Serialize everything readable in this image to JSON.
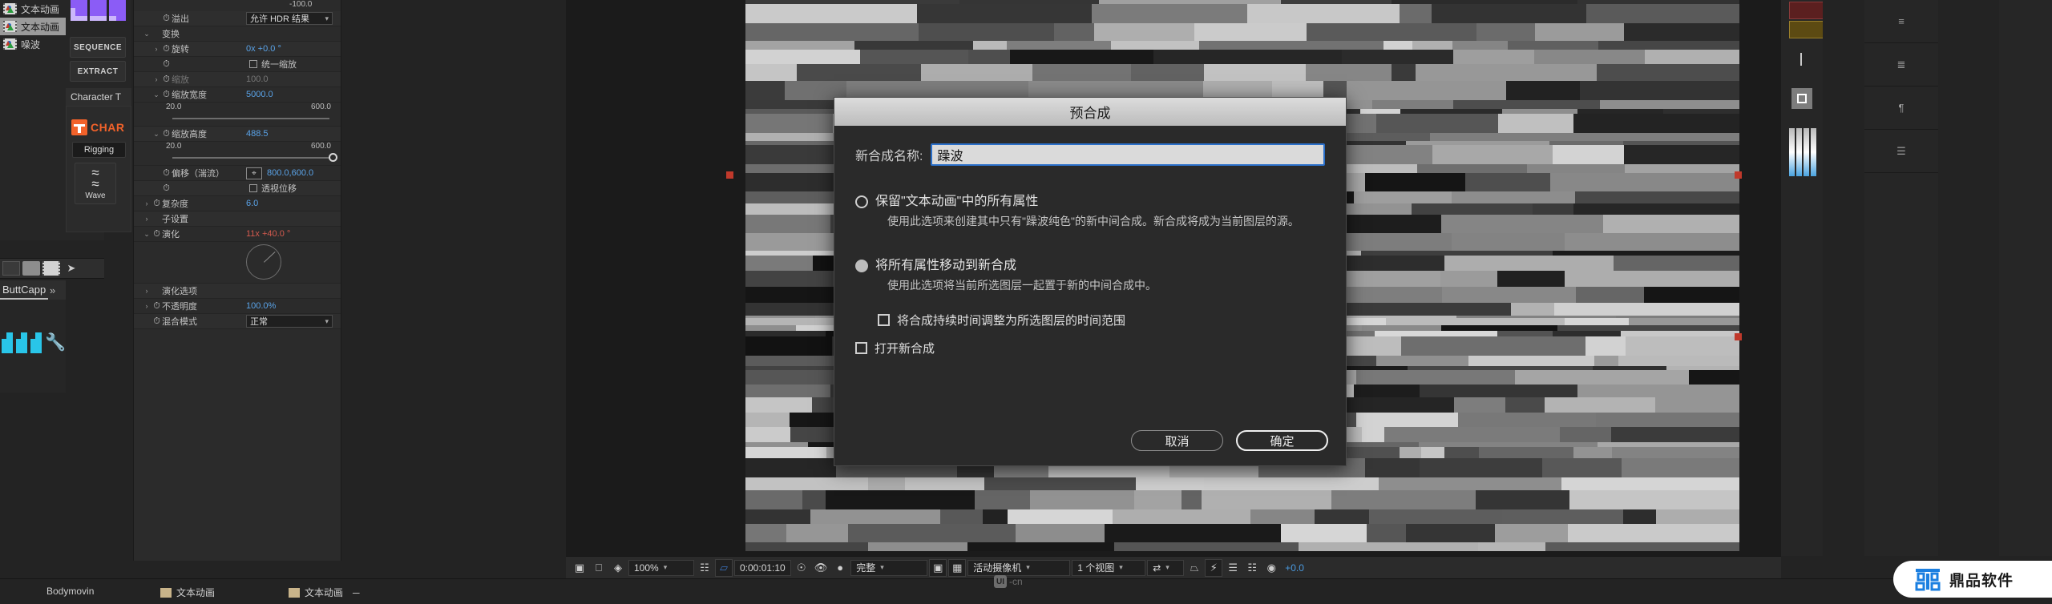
{
  "project": {
    "items": [
      {
        "label": "文本动画",
        "selected": false
      },
      {
        "label": "文本动画",
        "selected": true
      },
      {
        "label": "噪波",
        "selected": false
      }
    ]
  },
  "tools": {
    "sequence_label": "SEQUENCE",
    "extract_label": "EXTRACT"
  },
  "character_panel": {
    "tab_label": "Character T",
    "logo_text": "CHAR",
    "rigging_label": "Rigging",
    "wave_label": "Wave"
  },
  "buttcapp_panel": {
    "tab_label": "ButtCapp",
    "chevron": "»"
  },
  "effect_controls": {
    "top_value": "-100.0",
    "rows": [
      {
        "kind": "prop",
        "label": "溢出",
        "value": "允许 HDR 结果",
        "control": "dropdown",
        "indent": 1,
        "stopwatch": true,
        "twirl": ""
      },
      {
        "kind": "group",
        "label": "变换",
        "value": "",
        "control": "none",
        "indent": 0,
        "stopwatch": false,
        "twirl": "v"
      },
      {
        "kind": "prop",
        "label": "旋转",
        "value": "0x +0.0 °",
        "control": "text",
        "indent": 1,
        "stopwatch": true,
        "twirl": ">"
      },
      {
        "kind": "prop",
        "label": "",
        "value": "统一缩放",
        "control": "checkbox",
        "indent": 1,
        "stopwatch": true,
        "twirl": ""
      },
      {
        "kind": "prop",
        "label": "缩放",
        "value": "100.0",
        "control": "text",
        "indent": 1,
        "stopwatch": true,
        "twirl": ">",
        "dim": true
      },
      {
        "kind": "prop",
        "label": "缩放宽度",
        "value": "5000.0",
        "control": "text",
        "indent": 1,
        "stopwatch": true,
        "twirl": "v"
      },
      {
        "kind": "slider",
        "min": "20.0",
        "max": "600.0",
        "pos": 98
      },
      {
        "kind": "prop",
        "label": "缩放高度",
        "value": "488.5",
        "control": "text",
        "indent": 1,
        "stopwatch": true,
        "twirl": "v"
      },
      {
        "kind": "slider",
        "min": "20.0",
        "max": "600.0",
        "pos": 80
      },
      {
        "kind": "prop",
        "label": "偏移（湍流）",
        "value": "800.0,600.0",
        "control": "anchor",
        "indent": 1,
        "stopwatch": true,
        "twirl": ""
      },
      {
        "kind": "prop",
        "label": "",
        "value": "透视位移",
        "control": "checkbox",
        "indent": 1,
        "stopwatch": true,
        "twirl": ""
      },
      {
        "kind": "prop",
        "label": "复杂度",
        "value": "6.0",
        "control": "text",
        "indent": 0,
        "stopwatch": true,
        "twirl": ">"
      },
      {
        "kind": "group",
        "label": "子设置",
        "value": "",
        "control": "none",
        "indent": 0,
        "stopwatch": false,
        "twirl": ">"
      },
      {
        "kind": "prop",
        "label": "演化",
        "value": "11x +40.0 °",
        "control": "text",
        "indent": 0,
        "stopwatch": true,
        "twirl": "v",
        "red": true
      },
      {
        "kind": "dial"
      },
      {
        "kind": "group",
        "label": "演化选项",
        "value": "",
        "control": "none",
        "indent": 0,
        "stopwatch": false,
        "twirl": ">"
      },
      {
        "kind": "prop",
        "label": "不透明度",
        "value": "100.0%",
        "control": "text",
        "indent": 0,
        "stopwatch": true,
        "twirl": ">"
      },
      {
        "kind": "prop",
        "label": "混合模式",
        "value": "正常",
        "control": "dropdown",
        "indent": 0,
        "stopwatch": true,
        "twirl": ""
      }
    ]
  },
  "dialog": {
    "title": "预合成",
    "name_label": "新合成名称:",
    "name_value": "躁波",
    "options": [
      {
        "selected": false,
        "title": "保留\"文本动画\"中的所有属性",
        "desc": "使用此选项来创建其中只有\"躁波纯色\"的新中间合成。新合成将成为当前图层的源。"
      },
      {
        "selected": true,
        "title": "将所有属性移动到新合成",
        "desc": "使用此选项将当前所选图层一起置于新的中间合成中。"
      }
    ],
    "checkboxes": [
      {
        "label": "将合成持续时间调整为所选图层的时间范围",
        "checked": false,
        "indent": true
      },
      {
        "label": "打开新合成",
        "checked": false,
        "indent": false
      }
    ],
    "cancel_label": "取消",
    "ok_label": "确定"
  },
  "bottom_toolbar": {
    "zoom_value": "100%",
    "timecode": "0:00:01:10",
    "resolution": "完整",
    "camera": "活动摄像机",
    "views": "1 个视图",
    "exposure": "+0.0",
    "icons": [
      "always-preview-icon",
      "monitor-icon",
      "channel-icon",
      "region-of-interest-icon",
      "transparency-grid-icon",
      "snapshot-icon",
      "show-snapshot-icon",
      "channel-rgb-icon",
      "mask-icon",
      "grid-icon",
      "timecode-icon",
      "reset-exposure-icon",
      "graph-icon",
      "renderer-icon",
      "exposure-icon"
    ]
  },
  "timeline": {
    "tabs": [
      {
        "label": "Bodymovin",
        "swatch": false
      },
      {
        "label": "文本动画",
        "swatch": true
      },
      {
        "label": "文本动画",
        "swatch": true
      }
    ],
    "uicn_label": "-cn",
    "uicn_badge": "UI"
  },
  "watermark": {
    "text": "鼎品软件"
  },
  "colors": {
    "accent_blue": "#5aa3e8",
    "accent_red": "#d45a4e",
    "brand_orange": "#f2622a",
    "watermark_blue": "#1b7fe0",
    "dialog_focus": "#2a6fc9"
  }
}
